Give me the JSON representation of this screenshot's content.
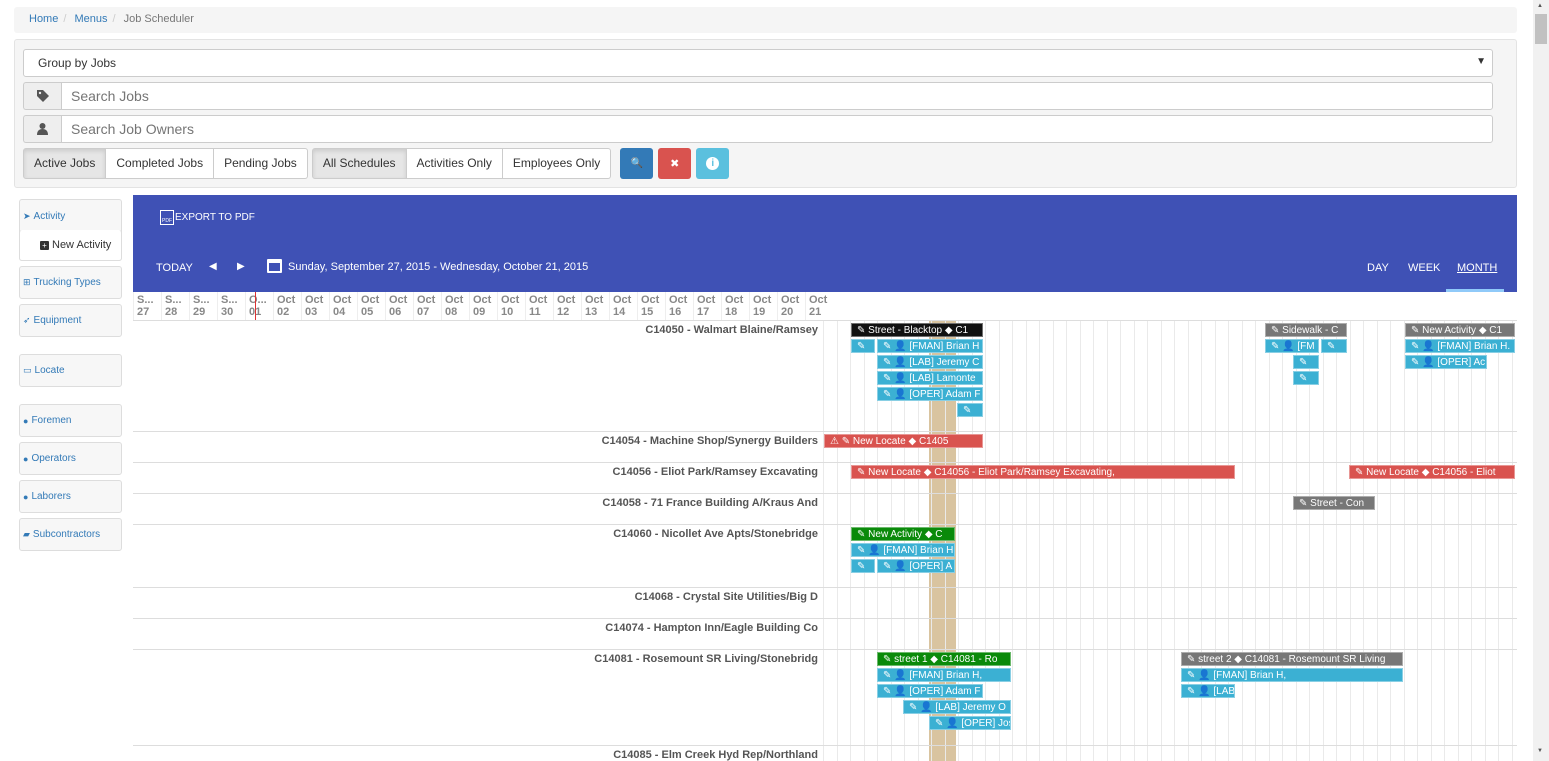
{
  "breadcrumb": {
    "home": "Home",
    "menus": "Menus",
    "current": "Job Scheduler"
  },
  "filters": {
    "group_select": "Group by Jobs",
    "search_jobs_placeholder": "Search Jobs",
    "search_owners_placeholder": "Search Job Owners",
    "status_buttons": [
      "Active Jobs",
      "Completed Jobs",
      "Pending Jobs"
    ],
    "schedule_buttons": [
      "All Schedules",
      "Activities Only",
      "Employees Only"
    ],
    "search_btn": "🔍",
    "clear_btn": "✖",
    "info_btn": "i"
  },
  "sidebar": {
    "activity": "Activity",
    "new_activity": "New Activity",
    "trucking": "Trucking Types",
    "equipment": "Equipment",
    "locate": "Locate",
    "foremen": "Foremen",
    "operators": "Operators",
    "laborers": "Laborers",
    "subcontractors": "Subcontractors"
  },
  "scheduler": {
    "export": "EXPORT TO PDF",
    "pdf_icon_text": "PDF",
    "today": "TODAY",
    "prev": "◀",
    "next": "▶",
    "range": "Sunday, September 27, 2015 - Wednesday, October 21, 2015",
    "views": {
      "day": "DAY",
      "week": "WEEK",
      "month": "MONTH"
    },
    "days": [
      {
        "m": "S...",
        "d": "27"
      },
      {
        "m": "S...",
        "d": "28"
      },
      {
        "m": "S...",
        "d": "29"
      },
      {
        "m": "S...",
        "d": "30"
      },
      {
        "m": "O...",
        "d": "01"
      },
      {
        "m": "Oct",
        "d": "02"
      },
      {
        "m": "Oct",
        "d": "03"
      },
      {
        "m": "Oct",
        "d": "04"
      },
      {
        "m": "Oct",
        "d": "05"
      },
      {
        "m": "Oct",
        "d": "06"
      },
      {
        "m": "Oct",
        "d": "07"
      },
      {
        "m": "Oct",
        "d": "08"
      },
      {
        "m": "Oct",
        "d": "09"
      },
      {
        "m": "Oct",
        "d": "10"
      },
      {
        "m": "Oct",
        "d": "11"
      },
      {
        "m": "Oct",
        "d": "12"
      },
      {
        "m": "Oct",
        "d": "13"
      },
      {
        "m": "Oct",
        "d": "14"
      },
      {
        "m": "Oct",
        "d": "15"
      },
      {
        "m": "Oct",
        "d": "16"
      },
      {
        "m": "Oct",
        "d": "17"
      },
      {
        "m": "Oct",
        "d": "18"
      },
      {
        "m": "Oct",
        "d": "19"
      },
      {
        "m": "Oct",
        "d": "20"
      },
      {
        "m": "Oct",
        "d": "21"
      }
    ],
    "jobs": [
      "C14050 - Walmart Blaine/Ramsey",
      "C14054 - Machine Shop/Synergy Builders",
      "C14056 - Eliot Park/Ramsey Excavating",
      "C14058 - 71 France Building A/Kraus And",
      "C14060 - Nicollet Ave Apts/Stonebridge",
      "C14068 - Crystal Site Utilities/Big D",
      "C14074 - Hampton Inn/Eagle Building Co",
      "C14081 - Rosemount SR Living/Stonebridg",
      "C14085 - Elm Creek Hyd Rep/Northland"
    ],
    "events": [
      {
        "c": "bk",
        "t": "✎ Street - Blacktop ◆ C1"
      },
      {
        "c": "bl",
        "t": "✎"
      },
      {
        "c": "bl",
        "t": "✎ 👤 [FMAN] Brian H"
      },
      {
        "c": "bl",
        "t": "✎ 👤 [LAB] Jeremy C"
      },
      {
        "c": "bl",
        "t": "✎ 👤 [LAB] Lamonte"
      },
      {
        "c": "bl",
        "t": "✎ 👤 [OPER] Adam F"
      },
      {
        "c": "bl",
        "t": "✎"
      },
      {
        "c": "gy",
        "t": "✎ Sidewalk - C"
      },
      {
        "c": "bl",
        "t": "✎ 👤 [FM"
      },
      {
        "c": "bl",
        "t": "✎"
      },
      {
        "c": "bl",
        "t": "✎"
      },
      {
        "c": "bl",
        "t": "✎"
      },
      {
        "c": "gy",
        "t": "✎ New Activity ◆ C1"
      },
      {
        "c": "bl",
        "t": "✎ 👤 [FMAN] Brian H."
      },
      {
        "c": "bl",
        "t": "✎ 👤 [OPER] Ac"
      },
      {
        "c": "rd",
        "t": "⚠ ✎ New Locate ◆ C1405"
      },
      {
        "c": "rd",
        "t": "✎ New Locate ◆ C14056 - Eliot Park/Ramsey Excavating,"
      },
      {
        "c": "rd",
        "t": "✎ New Locate ◆ C14056 - Eliot"
      },
      {
        "c": "gy",
        "t": "✎ Street - Con"
      },
      {
        "c": "gr",
        "t": "✎ New Activity ◆ C"
      },
      {
        "c": "bl",
        "t": "✎ 👤 [FMAN] Brian H"
      },
      {
        "c": "bl",
        "t": "✎"
      },
      {
        "c": "bl",
        "t": "✎ 👤 [OPER] A"
      },
      {
        "c": "gr",
        "t": "✎ street 1 ◆ C14081 - Ro"
      },
      {
        "c": "bl",
        "t": "✎ 👤 [FMAN] Brian H,"
      },
      {
        "c": "bl",
        "t": "✎ 👤 [OPER] Adam F"
      },
      {
        "c": "bl",
        "t": "✎ 👤 [LAB] Jeremy O"
      },
      {
        "c": "bl",
        "t": "✎ 👤 [OPER] Jos"
      },
      {
        "c": "gy",
        "t": "✎ street 2 ◆ C14081 - Rosemount SR Living"
      },
      {
        "c": "bl",
        "t": "✎ 👤 [FMAN] Brian H,"
      },
      {
        "c": "bl",
        "t": "✎ 👤 [LAB"
      }
    ]
  }
}
